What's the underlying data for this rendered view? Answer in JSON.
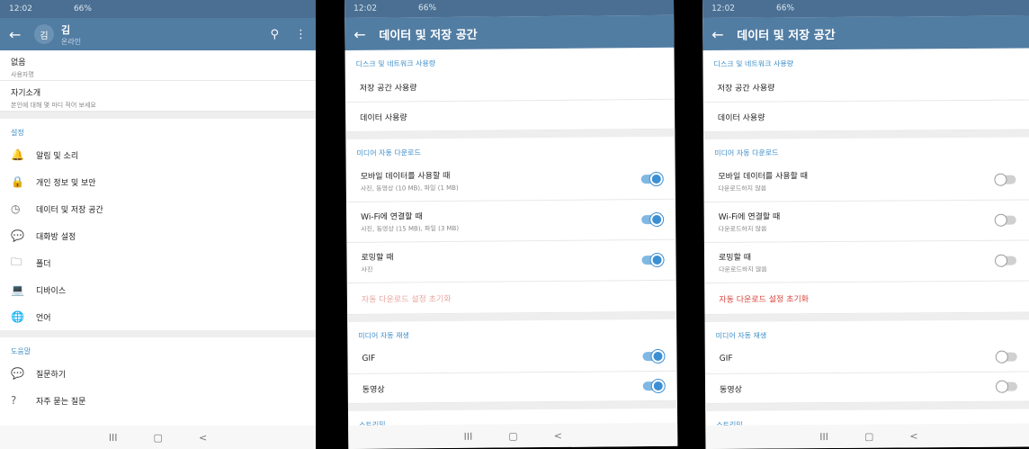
{
  "colors": {
    "accent": "#3d8ec9",
    "appbar": "#527da3",
    "status": "#4a6f92",
    "reset_faded": "#e8a7a2",
    "reset_active": "#d9443c",
    "toggle_on": "#3b8fd4"
  },
  "nav_icons": [
    "III",
    "▢",
    "<"
  ],
  "phone1": {
    "status_time": "12:02",
    "status_right": "66%",
    "avatar": "김",
    "name": "김",
    "status": "온라인",
    "profile": [
      {
        "title": "없음",
        "sub": "사용자명"
      },
      {
        "title": "자기소개",
        "sub": "본인에 대해 몇 마디 적어 보세요"
      }
    ],
    "settings_header": "설정",
    "settings": [
      {
        "icon": "bell-icon",
        "glyph": "🔔",
        "label": "알림 및 소리"
      },
      {
        "icon": "lock-icon",
        "glyph": "🔒",
        "label": "개인 정보 및 보안"
      },
      {
        "icon": "clock-icon",
        "glyph": "◷",
        "label": "데이터 및 저장 공간"
      },
      {
        "icon": "chat-icon",
        "glyph": "💬",
        "label": "대화방 설정"
      },
      {
        "icon": "folder-icon",
        "glyph": "🗀",
        "label": "폴더"
      },
      {
        "icon": "laptop-icon",
        "glyph": "💻",
        "label": "디바이스"
      },
      {
        "icon": "globe-icon",
        "glyph": "🌐",
        "label": "언어"
      }
    ],
    "help_header": "도움말",
    "help": [
      {
        "icon": "chat-dots-icon",
        "glyph": "💬",
        "label": "질문하기"
      },
      {
        "icon": "question-icon",
        "glyph": "?",
        "label": "자주 묻는 질문"
      }
    ]
  },
  "phone2": {
    "status_time": "12:02",
    "status_right": "66%",
    "title": "데이터 및 저장 공간",
    "disk_header": "디스크 및 네트워크 사용량",
    "disk": [
      "저장 공간 사용량",
      "데이터 사용량"
    ],
    "auto_header": "미디어 자동 다운로드",
    "auto": [
      {
        "title": "모바일 데이터를 사용할 때",
        "sub": "사진, 동영상 (10 MB), 파일 (1 MB)",
        "on": true
      },
      {
        "title": "Wi-Fi에 연결할 때",
        "sub": "사진, 동영상 (15 MB), 파일 (3 MB)",
        "on": true
      },
      {
        "title": "로밍할 때",
        "sub": "사진",
        "on": true
      }
    ],
    "reset": "자동 다운로드 설정 초기화",
    "play_header": "미디어 자동 재생",
    "play": [
      {
        "title": "GIF",
        "on": true
      },
      {
        "title": "동영상",
        "on": true
      }
    ],
    "stream_header": "스트리밍"
  },
  "phone3": {
    "status_time": "12:02",
    "status_right": "66%",
    "title": "데이터 및 저장 공간",
    "disk_header": "디스크 및 네트워크 사용량",
    "disk": [
      "저장 공간 사용량",
      "데이터 사용량"
    ],
    "auto_header": "미디어 자동 다운로드",
    "auto": [
      {
        "title": "모바일 데이터를 사용할 때",
        "sub": "다운로드하지 않음",
        "on": false
      },
      {
        "title": "Wi-Fi에 연결할 때",
        "sub": "다운로드하지 않음",
        "on": false
      },
      {
        "title": "로밍할 때",
        "sub": "다운로드하지 않음",
        "on": false
      }
    ],
    "reset": "자동 다운로드 설정 초기화",
    "play_header": "미디어 자동 재생",
    "play": [
      {
        "title": "GIF",
        "on": false
      },
      {
        "title": "동영상",
        "on": false
      }
    ],
    "stream_header": "스트리밍"
  }
}
